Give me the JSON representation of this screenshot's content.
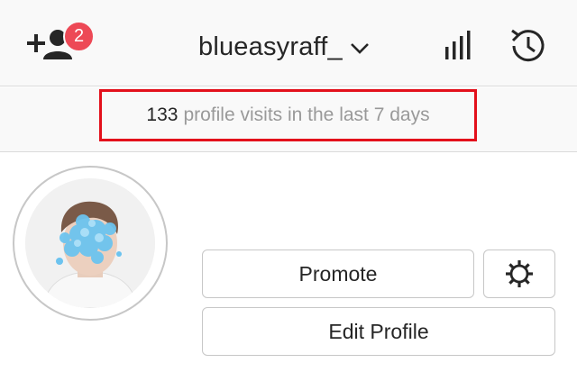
{
  "header": {
    "username": "blueasyraff_",
    "notification_count": "2",
    "icons": {
      "add_user": "add-user-icon",
      "dropdown": "chevron-down-icon",
      "insights": "bar-chart-icon",
      "archive": "history-clock-icon"
    }
  },
  "visits": {
    "count": "133",
    "label": "profile visits in the last 7 days"
  },
  "profile": {
    "avatar": "avatar",
    "buttons": {
      "promote": "Promote",
      "edit_profile": "Edit Profile"
    },
    "settings_icon": "gear-icon"
  },
  "colors": {
    "badge": "#ed4956",
    "highlight_border": "#e3101b",
    "muted_text": "#999999"
  }
}
